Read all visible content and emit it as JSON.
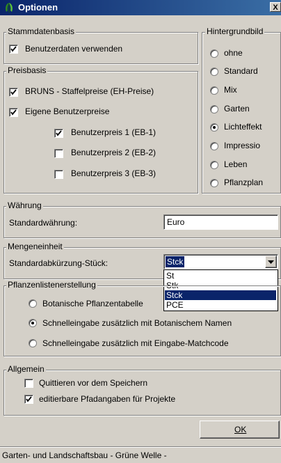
{
  "window": {
    "title": "Optionen",
    "close_glyph": "X",
    "icon": "leaf-icon"
  },
  "stammdaten": {
    "legend": "Stammdatenbasis",
    "benutzerdaten": {
      "label": "Benutzerdaten verwenden",
      "checked": true
    }
  },
  "preisbasis": {
    "legend": "Preisbasis",
    "bruns": {
      "label": "BRUNS - Staffelpreise (EH-Preise)",
      "checked": true
    },
    "eigene": {
      "label": "Eigene Benutzerpreise",
      "checked": true
    },
    "preise": [
      {
        "label": "Benutzerpreis 1 (EB-1)",
        "checked": true
      },
      {
        "label": "Benutzerpreis 2 (EB-2)",
        "checked": false
      },
      {
        "label": "Benutzerpreis 3 (EB-3)",
        "checked": false
      }
    ]
  },
  "hintergrund": {
    "legend": "Hintergrundbild",
    "options": [
      "ohne",
      "Standard",
      "Mix",
      "Garten",
      "Lichteffekt",
      "Impressio",
      "Leben",
      "Pflanzplan"
    ],
    "selected": "Lichteffekt"
  },
  "waehrung": {
    "legend": "Währung",
    "label": "Standardwährung:",
    "value": "Euro"
  },
  "menge": {
    "legend": "Mengeneinheit",
    "label": "Standardabkürzung-Stück:",
    "value": "Stck",
    "options": [
      "St",
      "Stk",
      "Stck",
      "PCE"
    ]
  },
  "pflanzen": {
    "legend": "Pflanzenlistenerstellung",
    "options": [
      "Botanische Pflanzentabelle",
      "Schnelleingabe zusätzlich mit Botanischem Namen",
      "Schnelleingabe zusätzlich mit Eingabe-Matchcode"
    ],
    "selected": "Schnelleingabe zusätzlich mit Botanischem Namen"
  },
  "allgemein": {
    "legend": "Allgemein",
    "quittieren": {
      "label": "Quittieren vor dem Speichern",
      "checked": false
    },
    "pfad": {
      "label": "editierbare Pfadangaben für Projekte",
      "checked": true
    }
  },
  "ok_button": {
    "label": "OK"
  },
  "status_bar": {
    "text": "Garten- und Landschaftsbau  - Grüne Welle -"
  }
}
